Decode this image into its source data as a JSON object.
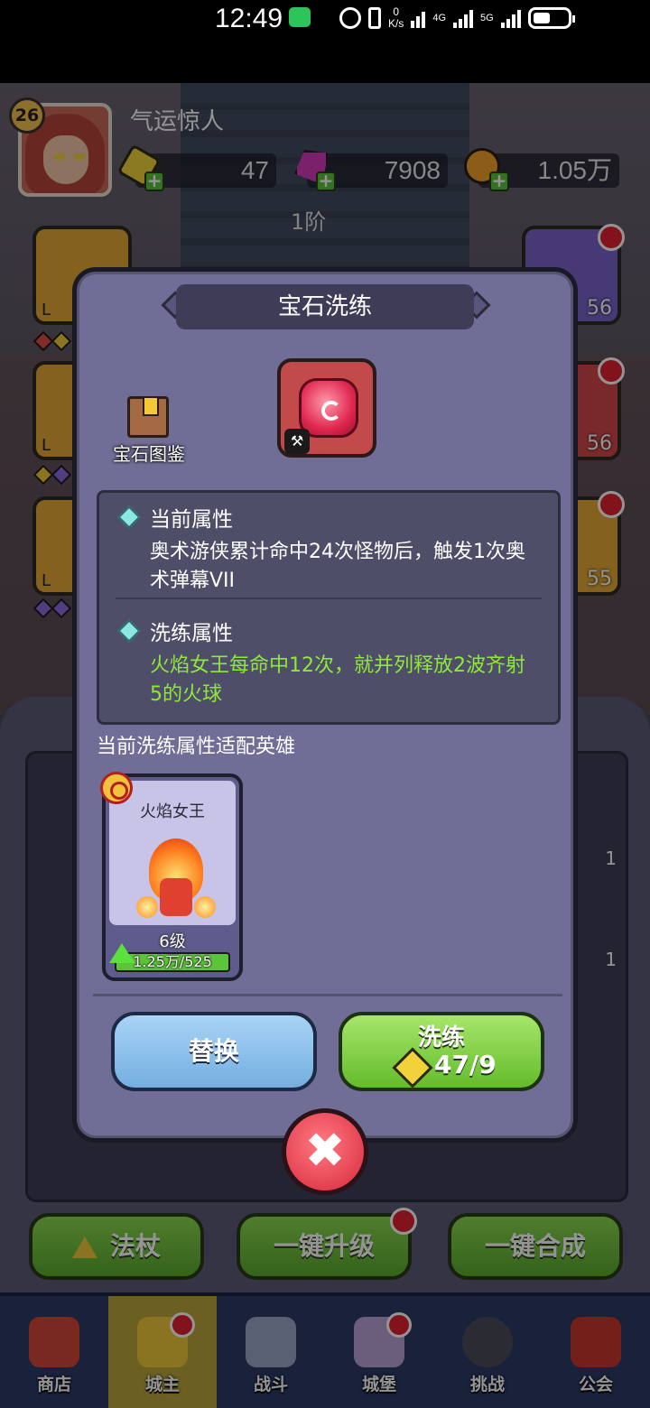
{
  "status_bar": {
    "time": "12:49",
    "speed_top": "0",
    "speed_unit": "K/s",
    "net1": "4G",
    "net2": "5G"
  },
  "player": {
    "level": "26",
    "name": "气运惊人",
    "gold": "47",
    "gems": "7908",
    "coins": "1.05万",
    "tier": "1阶"
  },
  "side_tiles": {
    "right_1_count": "56",
    "right_2_count": "56",
    "right_3_count": "55",
    "left_1_tag": "L",
    "left_2_tag": "L",
    "left_3_tag": "L",
    "inv_count_1": "1",
    "inv_count_2": "1"
  },
  "modal": {
    "title": "宝石洗练",
    "codex_label": "宝石图鉴",
    "current_attr_head": "当前属性",
    "current_attr_text": "奥术游侠累计命中24次怪物后，触发1次奥术弹幕VII",
    "refine_attr_head": "洗练属性",
    "refine_attr_text": "火焰女王每命中12次，就并列释放2波齐射5的火球",
    "fit_label": "当前洗练属性适配英雄",
    "hero": {
      "name": "火焰女王",
      "level": "6级",
      "progress_text": "1.25万/525",
      "progress_fraction": 1.0
    },
    "replace_label": "替换",
    "refine_label": "洗练",
    "refine_cost": "47/9",
    "close_symbol": "✖"
  },
  "bottom_buttons": {
    "staff": "法杖",
    "upgrade_all": "一键升级",
    "merge_all": "一键合成"
  },
  "nav": {
    "items": [
      {
        "label": "商店"
      },
      {
        "label": "城主"
      },
      {
        "label": "战斗"
      },
      {
        "label": "城堡"
      },
      {
        "label": "挑战"
      },
      {
        "label": "公会"
      }
    ]
  },
  "colors": {
    "refine_attr_text": "#8ee83a",
    "current_attr_text": "#ffffff",
    "modal_bg": "#706e96",
    "nav_active": "#b9a63a"
  },
  "icons": {
    "gold": "gold-gem-icon",
    "gems": "pink-gem-icon",
    "coins": "coin-icon",
    "codex": "book-icon",
    "gem_slot": "red-gem-icon",
    "close": "close-icon"
  }
}
